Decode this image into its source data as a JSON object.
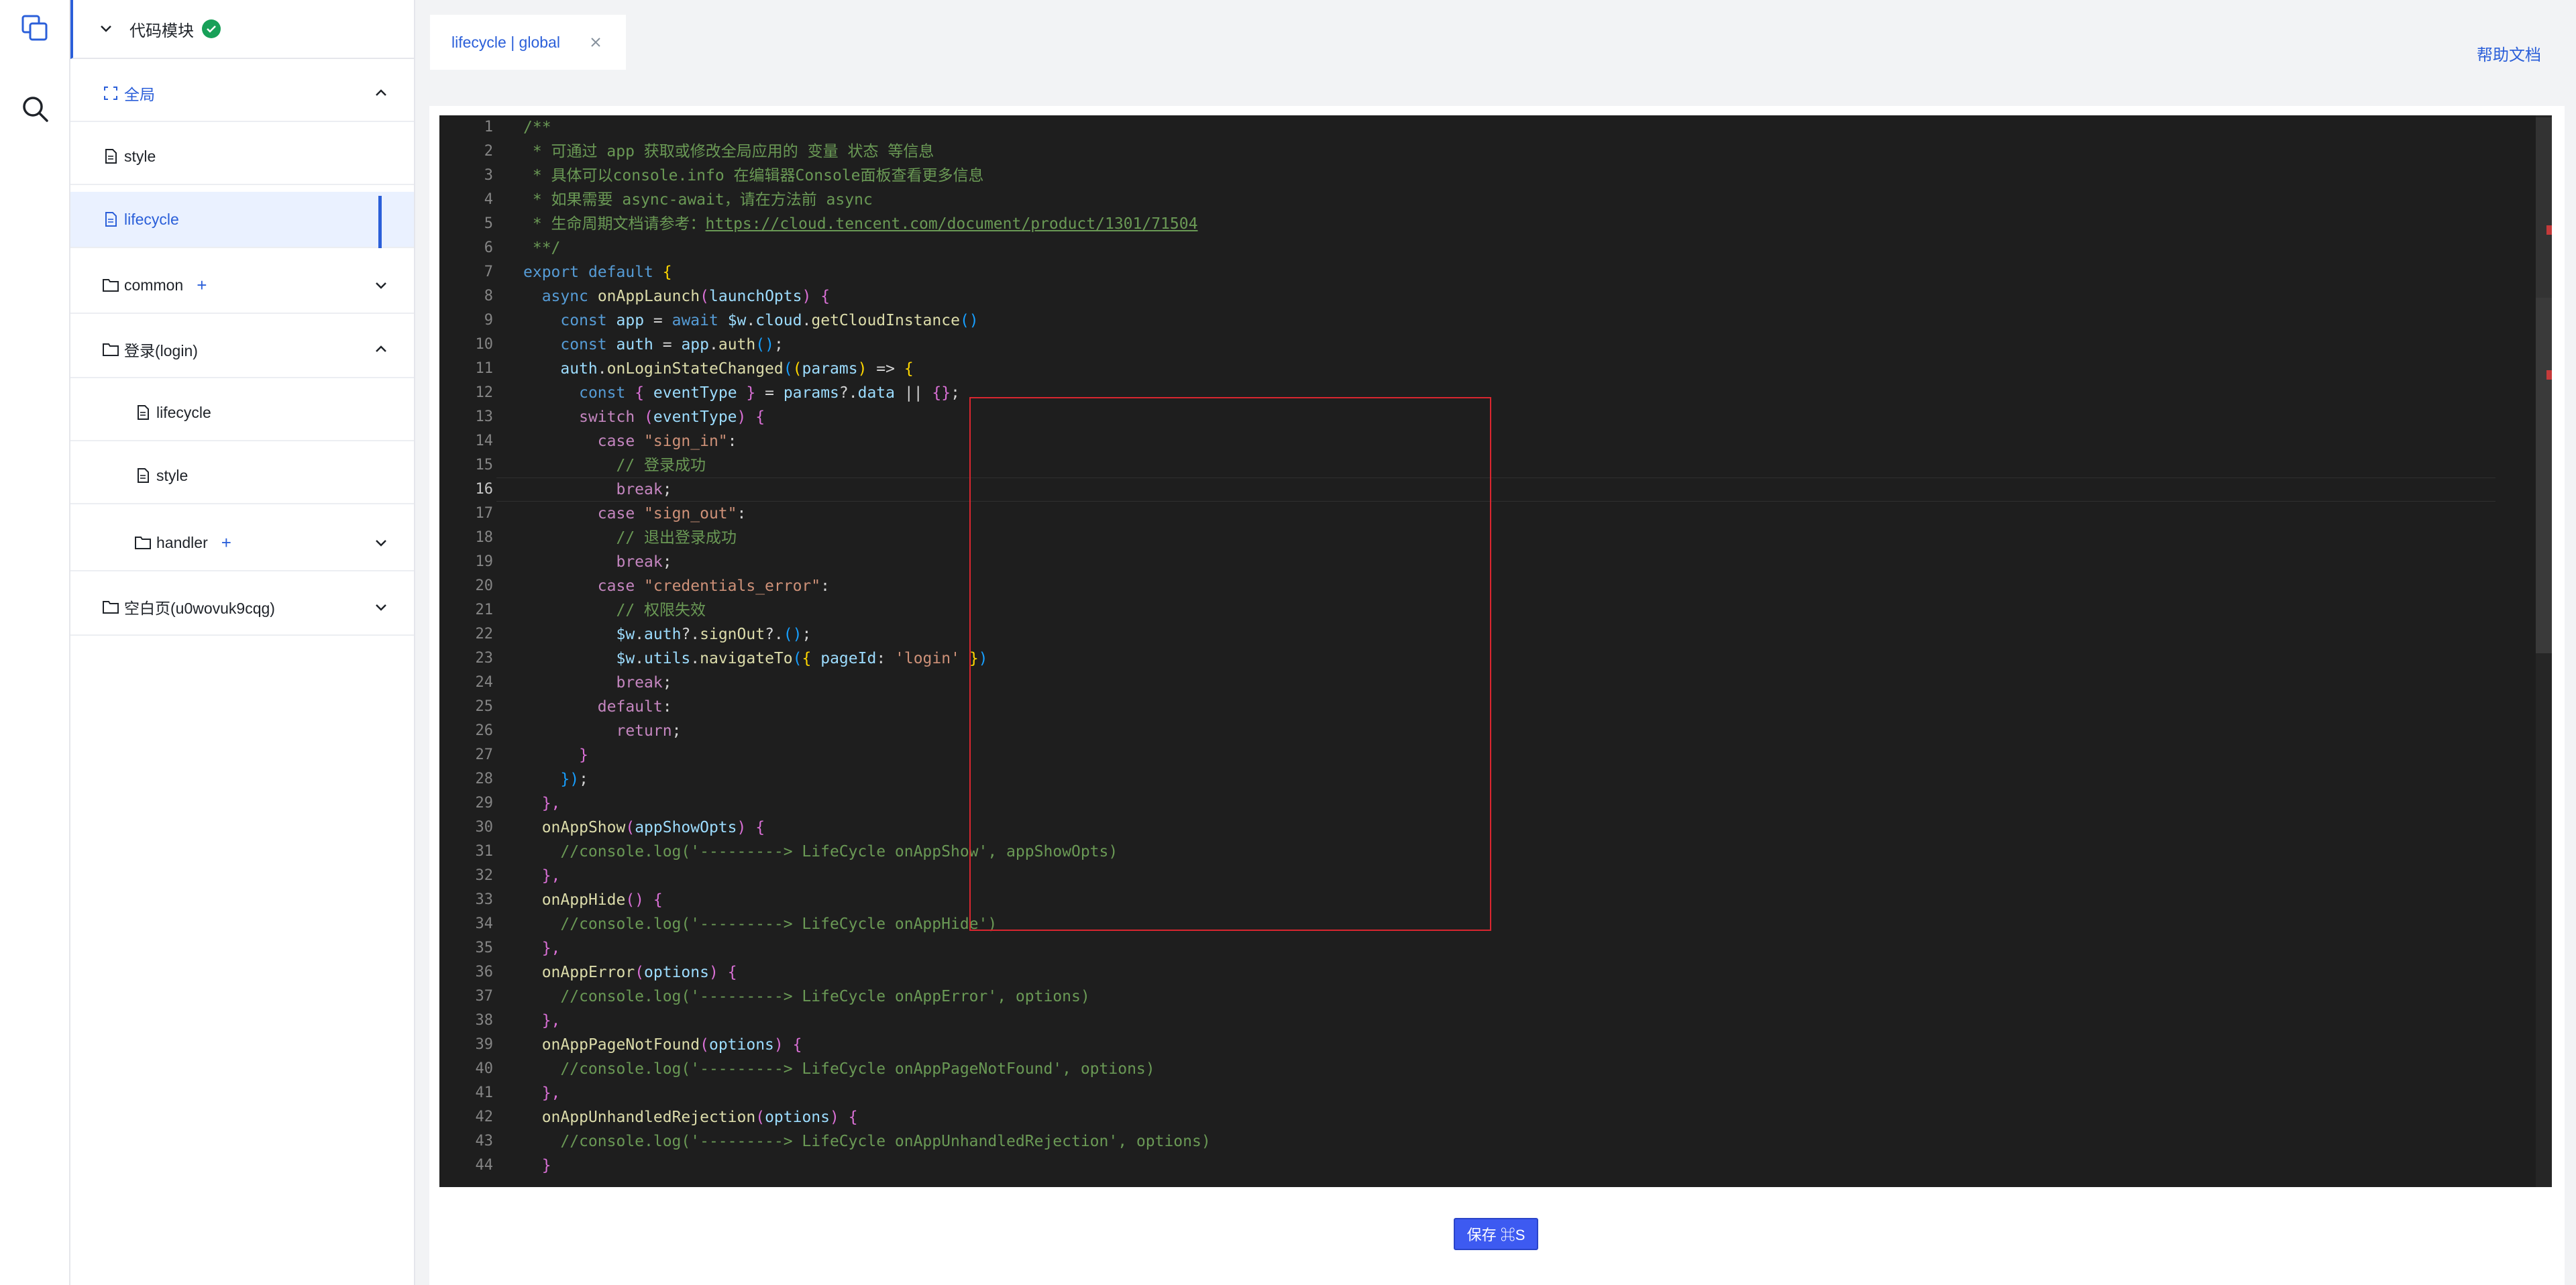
{
  "explorer": {
    "header_title": "代码模块",
    "items": [
      {
        "label": "全局"
      },
      {
        "label": "style"
      },
      {
        "label": "lifecycle"
      },
      {
        "label": "common",
        "plus": "+"
      },
      {
        "label": "登录(login)"
      },
      {
        "label": "lifecycle"
      },
      {
        "label": "style"
      },
      {
        "label": "handler",
        "plus": "+"
      },
      {
        "label": "空白页(u0wovuk9cqg)"
      }
    ]
  },
  "tab": {
    "label": "lifecycle | global"
  },
  "help_link": "帮助文档",
  "save_button": "保存 ⌘S",
  "editor": {
    "current_line": 16,
    "lines": [
      [
        [
          "/**",
          "com"
        ]
      ],
      [
        [
          " * 可通过 app 获取或修改全局应用的 变量 状态 等信息",
          "com"
        ]
      ],
      [
        [
          " * 具体可以console.info 在编辑器Console面板查看更多信息",
          "com"
        ]
      ],
      [
        [
          " * 如果需要 async-await，请在方法前 async",
          "com"
        ]
      ],
      [
        [
          " * 生命周期文档请参考：",
          "com"
        ],
        [
          "https://cloud.tencent.com/document/product/1301/71504",
          "url"
        ]
      ],
      [
        [
          " **/",
          "com"
        ]
      ],
      [
        [
          "export",
          "kw"
        ],
        [
          " "
        ],
        [
          "default",
          "kw"
        ],
        [
          " "
        ],
        [
          "{",
          "b1"
        ]
      ],
      [
        [
          "  "
        ],
        [
          "async",
          "kw"
        ],
        [
          " "
        ],
        [
          "onAppLaunch",
          "fn"
        ],
        [
          "(",
          "b2"
        ],
        [
          "launchOpts",
          "var"
        ],
        [
          ")",
          "b2"
        ],
        [
          " "
        ],
        [
          "{",
          "b2"
        ]
      ],
      [
        [
          "    "
        ],
        [
          "const",
          "kw"
        ],
        [
          " "
        ],
        [
          "app",
          "var"
        ],
        [
          " = "
        ],
        [
          "await",
          "kw"
        ],
        [
          " "
        ],
        [
          "$w",
          "var"
        ],
        [
          "."
        ],
        [
          "cloud",
          "var"
        ],
        [
          "."
        ],
        [
          "getCloudInstance",
          "fn"
        ],
        [
          "()",
          "b3"
        ]
      ],
      [
        [
          "    "
        ],
        [
          "const",
          "kw"
        ],
        [
          " "
        ],
        [
          "auth",
          "var"
        ],
        [
          " = "
        ],
        [
          "app",
          "var"
        ],
        [
          "."
        ],
        [
          "auth",
          "fn"
        ],
        [
          "()",
          "b3"
        ],
        [
          ";"
        ]
      ],
      [
        [
          "    "
        ],
        [
          "auth",
          "var"
        ],
        [
          "."
        ],
        [
          "onLoginStateChanged",
          "fn"
        ],
        [
          "(",
          "b3"
        ],
        [
          "(",
          "b1"
        ],
        [
          "params",
          "var"
        ],
        [
          ")",
          "b1"
        ],
        [
          " => "
        ],
        [
          "{",
          "b1"
        ]
      ],
      [
        [
          "      "
        ],
        [
          "const",
          "kw"
        ],
        [
          " "
        ],
        [
          "{",
          "b2"
        ],
        [
          " "
        ],
        [
          "eventType",
          "var"
        ],
        [
          " "
        ],
        [
          "}",
          "b2"
        ],
        [
          " = "
        ],
        [
          "params",
          "var"
        ],
        [
          "?."
        ],
        [
          "data",
          "var"
        ],
        [
          " || "
        ],
        [
          "{}",
          "b2"
        ],
        [
          ";"
        ]
      ],
      [
        [
          "      "
        ],
        [
          "switch",
          "ctl"
        ],
        [
          " "
        ],
        [
          "(",
          "b2"
        ],
        [
          "eventType",
          "var"
        ],
        [
          ")",
          "b2"
        ],
        [
          " "
        ],
        [
          "{",
          "b2"
        ]
      ],
      [
        [
          "        "
        ],
        [
          "case",
          "ctl"
        ],
        [
          " "
        ],
        [
          "\"sign_in\"",
          "str"
        ],
        [
          ":"
        ]
      ],
      [
        [
          "          "
        ],
        [
          "// 登录成功",
          "com"
        ]
      ],
      [
        [
          "          "
        ],
        [
          "break",
          "ctl"
        ],
        [
          ";"
        ]
      ],
      [
        [
          "        "
        ],
        [
          "case",
          "ctl"
        ],
        [
          " "
        ],
        [
          "\"sign_out\"",
          "str"
        ],
        [
          ":"
        ]
      ],
      [
        [
          "          "
        ],
        [
          "// 退出登录成功",
          "com"
        ]
      ],
      [
        [
          "          "
        ],
        [
          "break",
          "ctl"
        ],
        [
          ";"
        ]
      ],
      [
        [
          "        "
        ],
        [
          "case",
          "ctl"
        ],
        [
          " "
        ],
        [
          "\"credentials_error\"",
          "str"
        ],
        [
          ":"
        ]
      ],
      [
        [
          "          "
        ],
        [
          "// 权限失效",
          "com"
        ]
      ],
      [
        [
          "          "
        ],
        [
          "$w",
          "var"
        ],
        [
          "."
        ],
        [
          "auth",
          "var"
        ],
        [
          "?."
        ],
        [
          "signOut",
          "fn"
        ],
        [
          "?."
        ],
        [
          "()",
          "b3"
        ],
        [
          ";"
        ]
      ],
      [
        [
          "          "
        ],
        [
          "$w",
          "var"
        ],
        [
          "."
        ],
        [
          "utils",
          "var"
        ],
        [
          "."
        ],
        [
          "navigateTo",
          "fn"
        ],
        [
          "(",
          "b3"
        ],
        [
          "{",
          "b1"
        ],
        [
          " "
        ],
        [
          "pageId",
          "var"
        ],
        [
          ": "
        ],
        [
          "'login'",
          "str"
        ],
        [
          " "
        ],
        [
          "}",
          "b1"
        ],
        [
          ")",
          "b3"
        ]
      ],
      [
        [
          "          "
        ],
        [
          "break",
          "ctl"
        ],
        [
          ";"
        ]
      ],
      [
        [
          "        "
        ],
        [
          "default",
          "ctl"
        ],
        [
          ":"
        ]
      ],
      [
        [
          "          "
        ],
        [
          "return",
          "ctl"
        ],
        [
          ";"
        ]
      ],
      [
        [
          "      "
        ],
        [
          "}",
          "b2"
        ]
      ],
      [
        [
          "    "
        ],
        [
          "})",
          "b3"
        ],
        [
          ";"
        ]
      ],
      [
        [
          "  "
        ],
        [
          "},",
          "b2"
        ]
      ],
      [
        [
          "  "
        ],
        [
          "onAppShow",
          "fn"
        ],
        [
          "(",
          "b2"
        ],
        [
          "appShowOpts",
          "var"
        ],
        [
          ")",
          "b2"
        ],
        [
          " "
        ],
        [
          "{",
          "b2"
        ]
      ],
      [
        [
          "    "
        ],
        [
          "//console.log('---------> LifeCycle onAppShow', appShowOpts)",
          "com"
        ]
      ],
      [
        [
          "  "
        ],
        [
          "},",
          "b2"
        ]
      ],
      [
        [
          "  "
        ],
        [
          "onAppHide",
          "fn"
        ],
        [
          "()",
          "b2"
        ],
        [
          " "
        ],
        [
          "{",
          "b2"
        ]
      ],
      [
        [
          "    "
        ],
        [
          "//console.log('---------> LifeCycle onAppHide')",
          "com"
        ]
      ],
      [
        [
          "  "
        ],
        [
          "},",
          "b2"
        ]
      ],
      [
        [
          "  "
        ],
        [
          "onAppError",
          "fn"
        ],
        [
          "(",
          "b2"
        ],
        [
          "options",
          "var"
        ],
        [
          ")",
          "b2"
        ],
        [
          " "
        ],
        [
          "{",
          "b2"
        ]
      ],
      [
        [
          "    "
        ],
        [
          "//console.log('---------> LifeCycle onAppError', options)",
          "com"
        ]
      ],
      [
        [
          "  "
        ],
        [
          "},",
          "b2"
        ]
      ],
      [
        [
          "  "
        ],
        [
          "onAppPageNotFound",
          "fn"
        ],
        [
          "(",
          "b2"
        ],
        [
          "options",
          "var"
        ],
        [
          ")",
          "b2"
        ],
        [
          " "
        ],
        [
          "{",
          "b2"
        ]
      ],
      [
        [
          "    "
        ],
        [
          "//console.log('---------> LifeCycle onAppPageNotFound', options)",
          "com"
        ]
      ],
      [
        [
          "  "
        ],
        [
          "},",
          "b2"
        ]
      ],
      [
        [
          "  "
        ],
        [
          "onAppUnhandledRejection",
          "fn"
        ],
        [
          "(",
          "b2"
        ],
        [
          "options",
          "var"
        ],
        [
          ")",
          "b2"
        ],
        [
          " "
        ],
        [
          "{",
          "b2"
        ]
      ],
      [
        [
          "    "
        ],
        [
          "//console.log('---------> LifeCycle onAppUnhandledRejection', options)",
          "com"
        ]
      ],
      [
        [
          "  "
        ],
        [
          "}",
          "b2"
        ]
      ]
    ]
  }
}
